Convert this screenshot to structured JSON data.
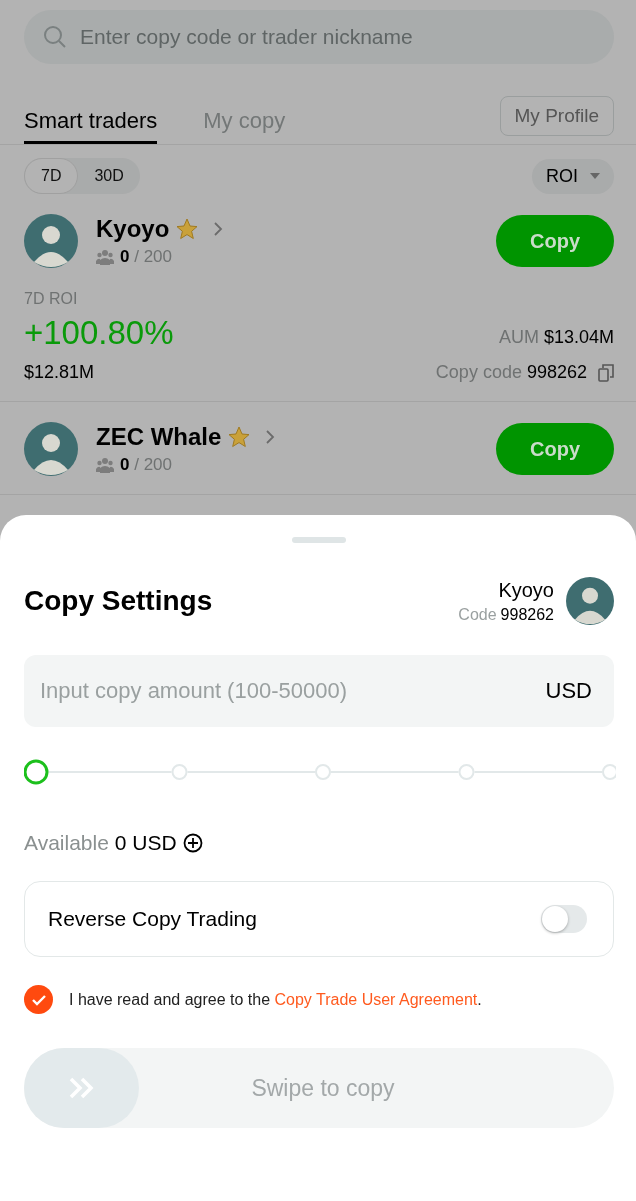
{
  "search": {
    "placeholder": "Enter copy code or trader nickname"
  },
  "tabs": [
    {
      "label": "Smart traders",
      "selected": true
    },
    {
      "label": "My copy",
      "selected": false
    }
  ],
  "profile_button": "My Profile",
  "periods": [
    {
      "label": "7D",
      "selected": true
    },
    {
      "label": "30D",
      "selected": false
    }
  ],
  "sort": {
    "label": "ROI"
  },
  "traders": [
    {
      "name": "Kyoyo",
      "copiers": "0",
      "capacity": "/ 200",
      "button": "Copy",
      "roi_label": "7D ROI",
      "roi": "+100.80%",
      "pnl": "$12.81M",
      "aum_label": "AUM",
      "aum": "$13.04M",
      "code_label": "Copy code",
      "code": "998262"
    },
    {
      "name": "ZEC Whale",
      "copiers": "0",
      "capacity": "/ 200",
      "button": "Copy"
    }
  ],
  "sheet": {
    "title": "Copy Settings",
    "trader": {
      "name": "Kyoyo",
      "code_label": "Code",
      "code": "998262"
    },
    "amount": {
      "placeholder": "Input copy amount (100-50000)",
      "unit": "USD"
    },
    "slider": {
      "level": 0
    },
    "available": {
      "label": "Available",
      "value": "0 USD"
    },
    "reverse": {
      "label": "Reverse Copy Trading",
      "on": false
    },
    "agreement": {
      "checked": true,
      "text": "I have read and agree to the ",
      "link": "Copy Trade User Agreement",
      "end": "."
    },
    "swipe": {
      "label": "Swipe to copy"
    }
  }
}
